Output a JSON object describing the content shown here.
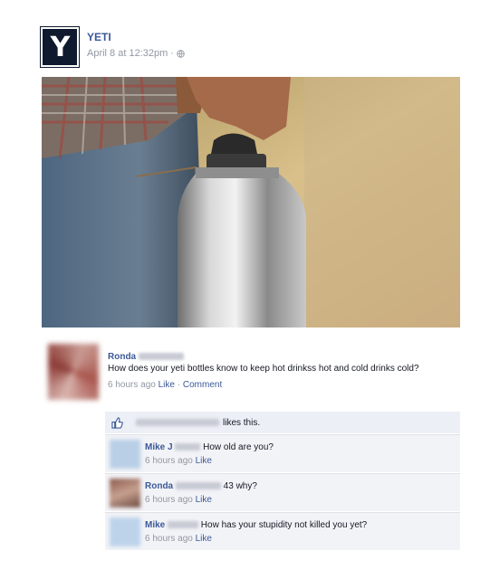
{
  "post": {
    "logo_letter": "Y",
    "page_name": "YETI",
    "timestamp": "April 8 at 12:32pm",
    "separator": "·",
    "privacy_icon": "globe-icon"
  },
  "photo": {
    "description_icon": "photo"
  },
  "comment": {
    "author": "Ronda",
    "text": "How does your yeti bottles know to keep hot drinkss hot and cold drinks cold?",
    "time": "6 hours ago",
    "like_label": "Like",
    "dot": "·",
    "comment_label": "Comment"
  },
  "likes": {
    "text": "likes this."
  },
  "replies": [
    {
      "author": "Mike J",
      "text": "How old are you?",
      "time": "6 hours ago",
      "like_label": "Like",
      "avatar_color": "#b9cfe6"
    },
    {
      "author": "Ronda",
      "text": "43 why?",
      "time": "6 hours ago",
      "like_label": "Like",
      "avatar_color": "#b07a6a"
    },
    {
      "author": "Mike",
      "text": "How has your stupidity not killed you yet?",
      "time": "6 hours ago",
      "like_label": "Like",
      "avatar_color": "#bcd3ea"
    }
  ]
}
